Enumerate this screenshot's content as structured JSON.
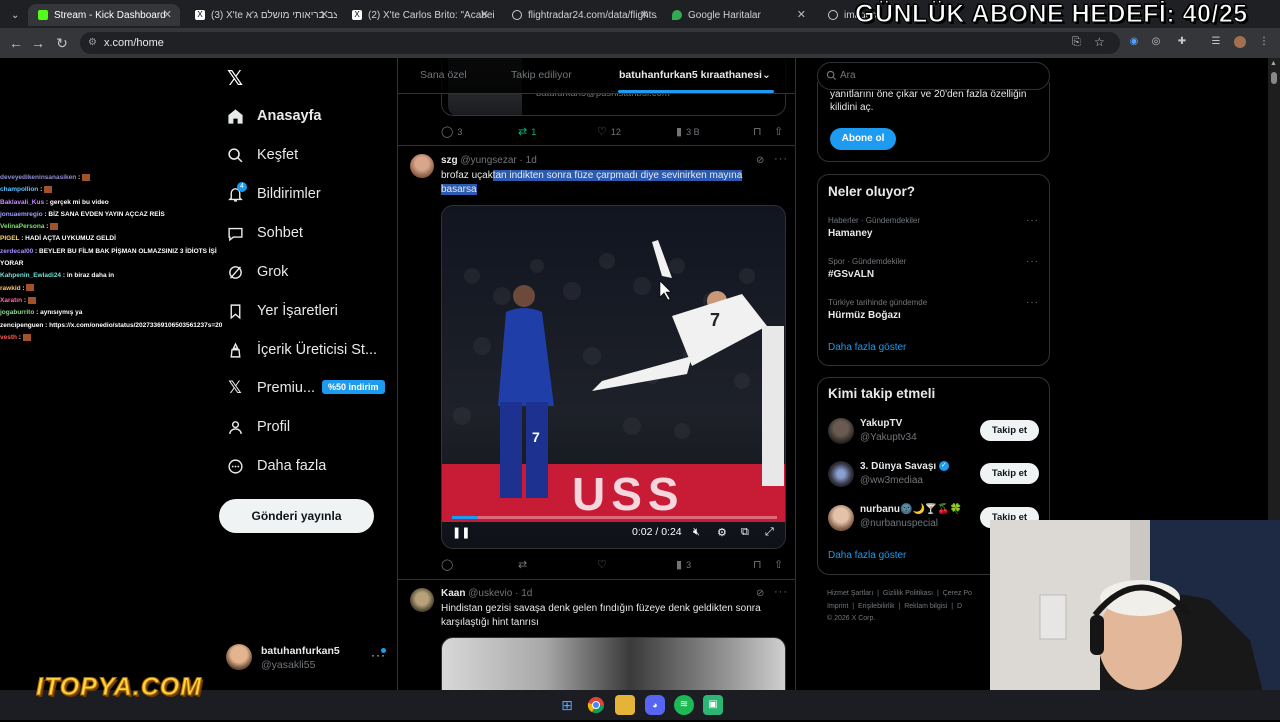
{
  "browser": {
    "tabs": [
      {
        "title": "Stream - Kick Dashboard",
        "icon": "kick-icon"
      },
      {
        "title": "(3) X'te במצב בריאותי מושלם ג'א",
        "icon": "x-icon"
      },
      {
        "title": "(2) X'te Carlos Brito: \"Acabei de",
        "icon": "x-icon"
      },
      {
        "title": "flightradar24.com/data/flights/",
        "icon": "globe-icon"
      },
      {
        "title": "Google Haritalar",
        "icon": "maps-icon"
      },
      {
        "title": "images",
        "icon": "globe-icon"
      }
    ],
    "url": "x.com/home"
  },
  "overlay": {
    "goal_text": "GÜNLÜK ABONE HEDEFİ: 40/25",
    "sponsor": "ITOPYA.COM"
  },
  "chat": [
    {
      "user": "deveyedikeninsanasiken",
      "msg": "",
      "color": "#8f8fd6"
    },
    {
      "user": "champollion",
      "msg": "",
      "color": "#5ec4ff"
    },
    {
      "user": "Baklavali_Kus",
      "msg": "gerçek mi bu video",
      "color": "#c98bff"
    },
    {
      "user": "jonuaemregio",
      "msg": "BİZ SANA EVDEN YAYIN AÇCAZ REİS",
      "color": "#9aa0ff"
    },
    {
      "user": "VelinaPersona",
      "msg": "",
      "color": "#7ee06e"
    },
    {
      "user": "PIGEL",
      "msg": "HADİ AÇTA UYKUMUZ GELDİ",
      "color": "#ffd86e"
    },
    {
      "user": "zerdecal00",
      "msg": "BEYLER BU FİLM BAK PİŞMAN OLMAZSINIZ 3 İDİOTS İŞİ YORAR",
      "color": "#a98cff"
    },
    {
      "user": "Kahpenin_Ewladi24",
      "msg": "in biraz daha in",
      "color": "#6ee0d6"
    },
    {
      "user": "rawkid",
      "msg": "",
      "color": "#ffc06e"
    },
    {
      "user": "Xaratın",
      "msg": "",
      "color": "#ff6e9a"
    },
    {
      "user": "jogaburrito",
      "msg": "aynısıymış ya",
      "color": "#8fd68f"
    },
    {
      "user": "zencipenguen",
      "msg": "https://x.com/onedio/status/20273369106503561237s=20",
      "color": "#ffffff"
    },
    {
      "user": "vesth",
      "msg": "",
      "color": "#ff5b5b"
    }
  ],
  "nav": {
    "items": [
      {
        "label": "Anasayfa",
        "icon": "home-icon"
      },
      {
        "label": "Keşfet",
        "icon": "search-icon"
      },
      {
        "label": "Bildirimler",
        "icon": "bell-icon"
      },
      {
        "label": "Sohbet",
        "icon": "chat-icon"
      },
      {
        "label": "Grok",
        "icon": "grok-icon"
      },
      {
        "label": "Yer İşaretleri",
        "icon": "bookmark-icon"
      },
      {
        "label": "İçerik Üreticisi St...",
        "icon": "creator-studio-icon"
      },
      {
        "label": "Premiu...",
        "icon": "x-premium-icon"
      },
      {
        "label": "Profil",
        "icon": "person-icon"
      },
      {
        "label": "Daha fazla",
        "icon": "more-circle-icon"
      }
    ],
    "notif_count": "4",
    "premium_badge": "%50 indirim",
    "post_button": "Gönderi yayınla",
    "account": {
      "name": "batuhanfurkan5",
      "handle": "@yasakli55"
    }
  },
  "feed": {
    "tabs": [
      "Sana özel",
      "Takip ediliyor",
      "batuhanfurkan5 kıraathanesi"
    ],
    "prev_tweet": {
      "email": "batufurkan5@pushistanbul.com",
      "replies": "3",
      "reposts": "1",
      "likes": "12",
      "views": "3 B"
    },
    "tweet1": {
      "name": "szg",
      "handle": "@yungsezar",
      "time": "1d",
      "text_plain": "brofaz uçak",
      "text_highlight": "tan indikten sonra füze çarpmadı diye sevinirken mayına basarsa",
      "video_time": "0:02 / 0:24",
      "video_progress": 0.08,
      "views": "3"
    },
    "tweet2": {
      "name": "Kaan",
      "handle": "@uskevio",
      "time": "1d",
      "text": "Hindistan gezisi savaşa denk gelen fındığın füzeye denk geldikten sonra karşılaştığı hint tanrısı"
    }
  },
  "right": {
    "search_placeholder": "Ara",
    "premium_text": "yanıtlarını öne çıkar ve 20'den fazla özelliğin kilidini aç.",
    "premium_button": "Abone ol",
    "trends_title": "Neler oluyor?",
    "trends": [
      {
        "meta": "Haberler · Gündemdekiler",
        "name": "Hamaney"
      },
      {
        "meta": "Spor · Gündemdekiler",
        "name": "#GSvALN"
      },
      {
        "meta": "Türkiye tarihinde gündemde",
        "name": "Hürmüz Boğazı"
      }
    ],
    "trends_more": "Daha fazla göster",
    "who_title": "Kimi takip etmeli",
    "who": [
      {
        "name": "YakupTV",
        "handle": "@Yakuptv34",
        "button": "Takip et"
      },
      {
        "name": "3. Dünya Savaşı",
        "handle": "@ww3mediaa",
        "button": "Takip et"
      },
      {
        "name": "nurbanu🌚🌙🍸🍒🍀",
        "handle": "@nurbanuspecial",
        "button": "Takip et"
      }
    ],
    "who_more": "Daha fazla göster",
    "footer": [
      "Hizmet Şartları",
      "Gizlilik Politikası",
      "Çerez Po",
      "Imprint",
      "Erişilebilirlik",
      "Reklam bilgisi",
      "D",
      "© 2026 X Corp."
    ]
  },
  "colors": {
    "accent": "#1d9bf0",
    "bg": "#000000",
    "text": "#e7e9ea",
    "muted": "#71767b",
    "border": "#2f3336"
  }
}
